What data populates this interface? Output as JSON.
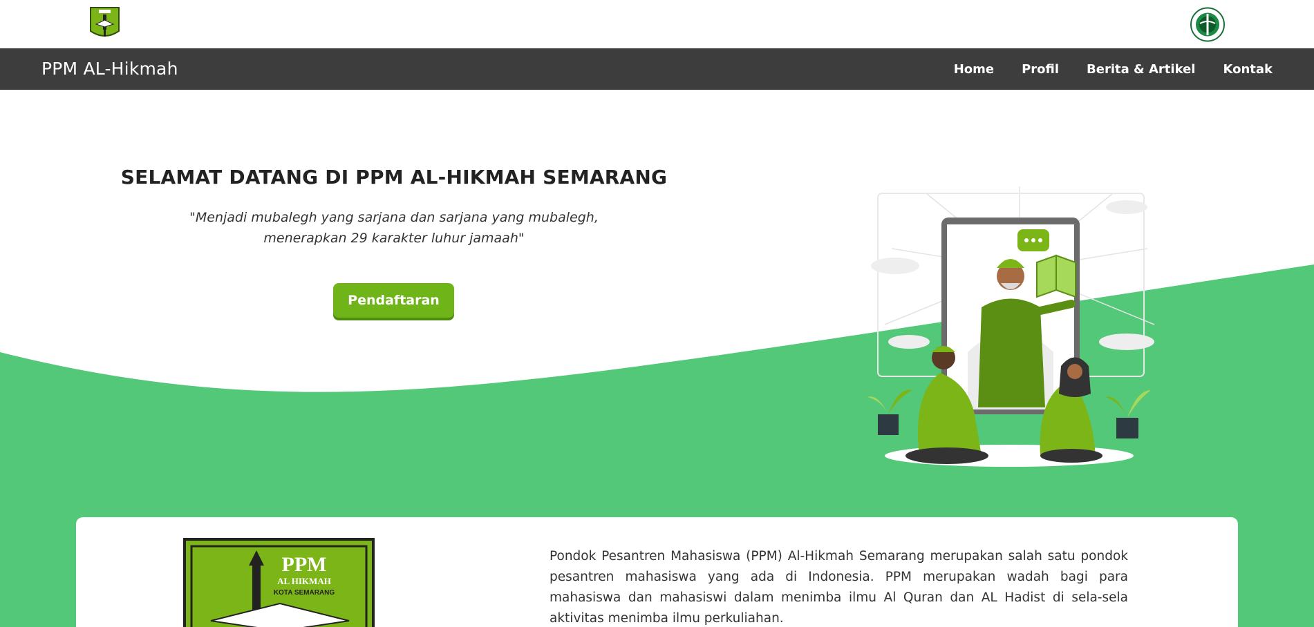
{
  "header": {
    "brand": "PPM AL-Hikmah",
    "nav": [
      {
        "label": "Home"
      },
      {
        "label": "Profil"
      },
      {
        "label": "Berita & Artikel"
      },
      {
        "label": "Kontak"
      }
    ]
  },
  "hero": {
    "title": "SELAMAT DATANG DI PPM AL-HIKMAH SEMARANG",
    "quote_line1": "\"Menjadi mubalegh yang sarjana dan sarjana yang mubalegh,",
    "quote_line2": "menerapkan 29 karakter luhur jamaah\"",
    "cta_label": "Pendaftaran"
  },
  "about": {
    "logo_text": [
      "PPM",
      "AL HIKMAH",
      "KOTA SEMARANG"
    ],
    "description": "Pondok Pesantren Mahasiswa (PPM) Al-Hikmah Semarang merupakan salah satu pondok pesantren mahasiswa yang ada di Indonesia. PPM merupakan wadah bagi para mahasiswa dan mahasiswi dalam menimba ilmu Al Quran dan AL Hadist di sela-sela aktivitas menimba ilmu perkuliahan."
  },
  "colors": {
    "navbar": "#3d3d3d",
    "accent_green": "#52c878",
    "button_green": "#6fb51a",
    "logo_green": "#7cb518"
  },
  "icons": [
    "ppm-logo-icon",
    "university-emblem-icon",
    "teacher-students-illustration"
  ]
}
